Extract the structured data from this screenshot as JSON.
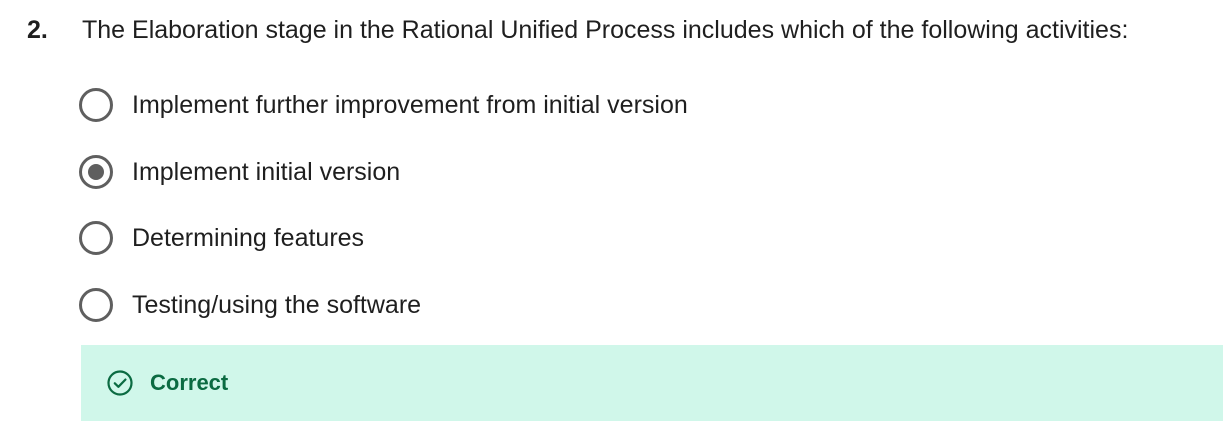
{
  "question": {
    "number": "2.",
    "text": "The Elaboration stage in the Rational Unified Process includes which of the following activities:"
  },
  "options": [
    {
      "label": "Implement further improvement from initial version",
      "selected": false
    },
    {
      "label": "Implement initial version",
      "selected": true
    },
    {
      "label": "Determining features",
      "selected": false
    },
    {
      "label": "Testing/using the software",
      "selected": false
    }
  ],
  "feedback": {
    "label": "Correct",
    "icon": "check-circle-icon",
    "color": "#0b6b42",
    "background": "#d0f7ea"
  }
}
